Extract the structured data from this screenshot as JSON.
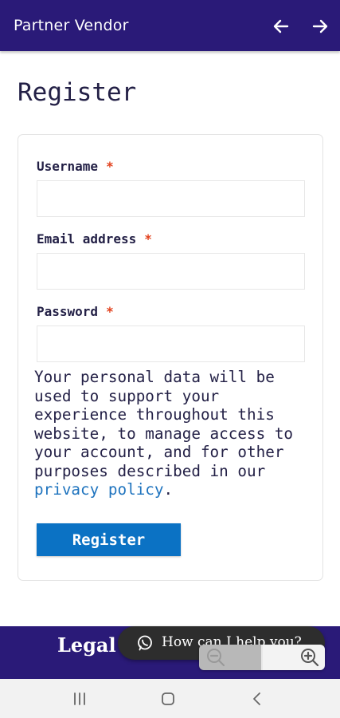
{
  "appbar": {
    "title": "Partner Vendor",
    "back_icon": "arrow-left-icon",
    "forward_icon": "arrow-right-icon"
  },
  "page": {
    "title": "Register"
  },
  "form": {
    "username": {
      "label": "Username",
      "required_mark": "*",
      "value": ""
    },
    "email": {
      "label": "Email address",
      "required_mark": "*",
      "value": ""
    },
    "password": {
      "label": "Password",
      "required_mark": "*",
      "value": ""
    },
    "privacy_text": "Your personal data will be used to support your experience throughout this website, to manage access to your account, and for other purposes described in our ",
    "privacy_link": "privacy policy",
    "privacy_end": ".",
    "submit_label": "Register"
  },
  "footer": {
    "legal": "Legal"
  },
  "chat": {
    "icon": "whatsapp-icon",
    "text": "How can I help you?"
  },
  "zoom": {
    "out_icon": "zoom-out-icon",
    "in_icon": "zoom-in-icon"
  },
  "system_nav": {
    "recents_icon": "recents-icon",
    "home_icon": "home-icon",
    "back_icon": "back-icon"
  },
  "colors": {
    "appbar": "#2a1a78",
    "accent_button": "#0b72c4",
    "link": "#1e73be",
    "required": "#e2401c",
    "text": "#232046"
  }
}
